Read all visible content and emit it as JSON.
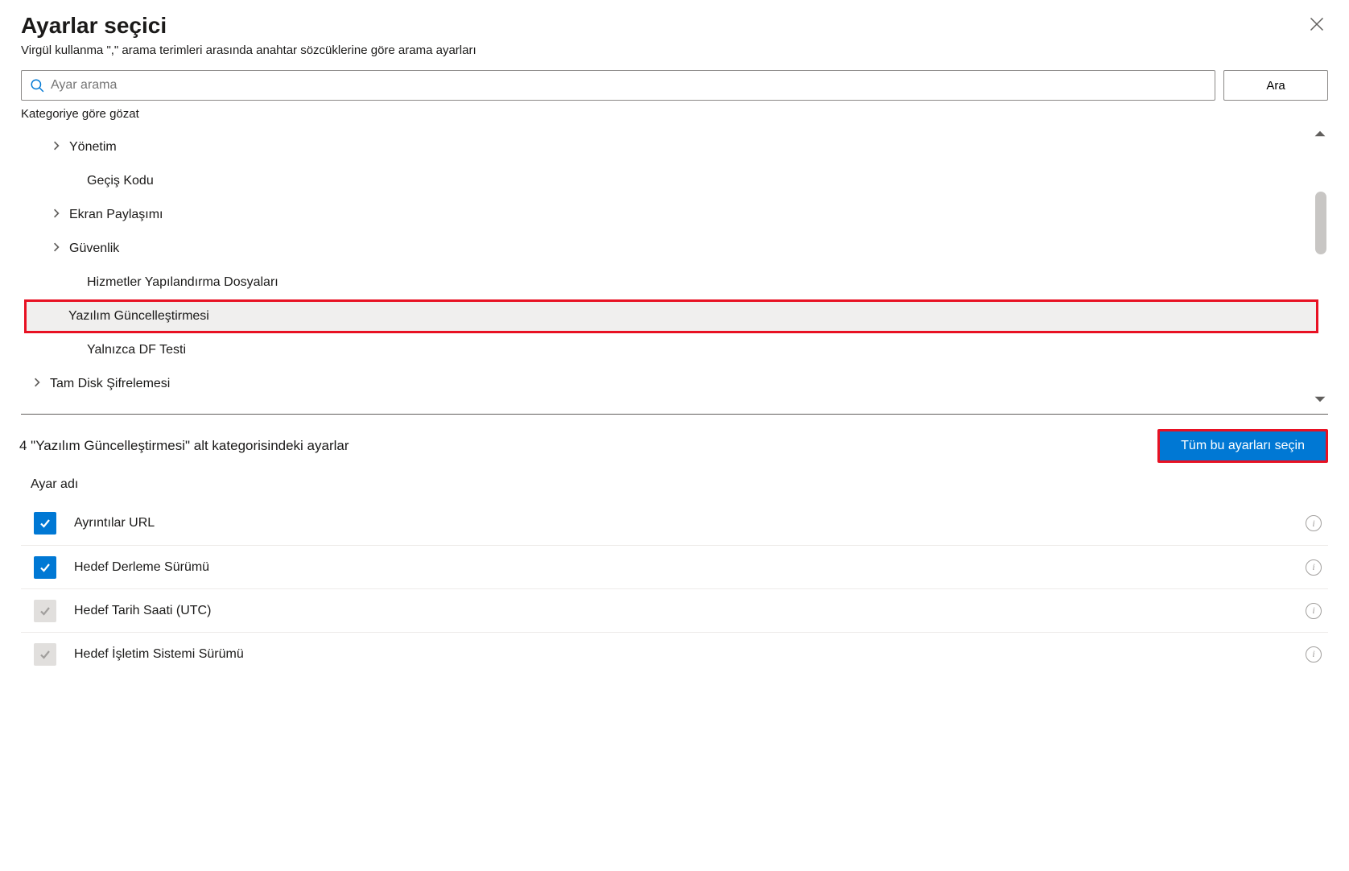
{
  "header": {
    "title": "Ayarlar seçici",
    "subtitle": "Virgül kullanma \",\" arama terimleri arasında anahtar sözcüklerine göre arama ayarları"
  },
  "search": {
    "placeholder": "Ayar arama",
    "button_label": "Ara",
    "browse_label": "Kategoriye göre gözat"
  },
  "categories": [
    {
      "label": "Yönetim",
      "expandable": true,
      "level": 1,
      "highlighted": false
    },
    {
      "label": "Geçiş Kodu",
      "expandable": false,
      "level": 1,
      "highlighted": false
    },
    {
      "label": "Ekran Paylaşımı",
      "expandable": true,
      "level": 1,
      "highlighted": false
    },
    {
      "label": "Güvenlik",
      "expandable": true,
      "level": 1,
      "highlighted": false
    },
    {
      "label": "Hizmetler Yapılandırma Dosyaları",
      "expandable": false,
      "level": 1,
      "highlighted": false
    },
    {
      "label": "Yazılım Güncelleştirmesi",
      "expandable": false,
      "level": 1,
      "highlighted": true
    },
    {
      "label": "Yalnızca DF Testi",
      "expandable": false,
      "level": 1,
      "highlighted": false
    },
    {
      "label": "Tam Disk Şifrelemesi",
      "expandable": true,
      "level": 0,
      "highlighted": false
    }
  ],
  "results": {
    "heading": "4 \"Yazılım Güncelleştirmesi\" alt kategorisindeki ayarlar",
    "select_all_label": "Tüm bu ayarları seçin",
    "column_header": "Ayar adı"
  },
  "settings": [
    {
      "label": "Ayrıntılar URL",
      "checked": true,
      "grey": false
    },
    {
      "label": "Hedef Derleme Sürümü",
      "checked": true,
      "grey": false
    },
    {
      "label": "Hedef Tarih Saati (UTC)",
      "checked": true,
      "grey": true
    },
    {
      "label": "Hedef İşletim Sistemi Sürümü",
      "checked": true,
      "grey": true
    }
  ]
}
